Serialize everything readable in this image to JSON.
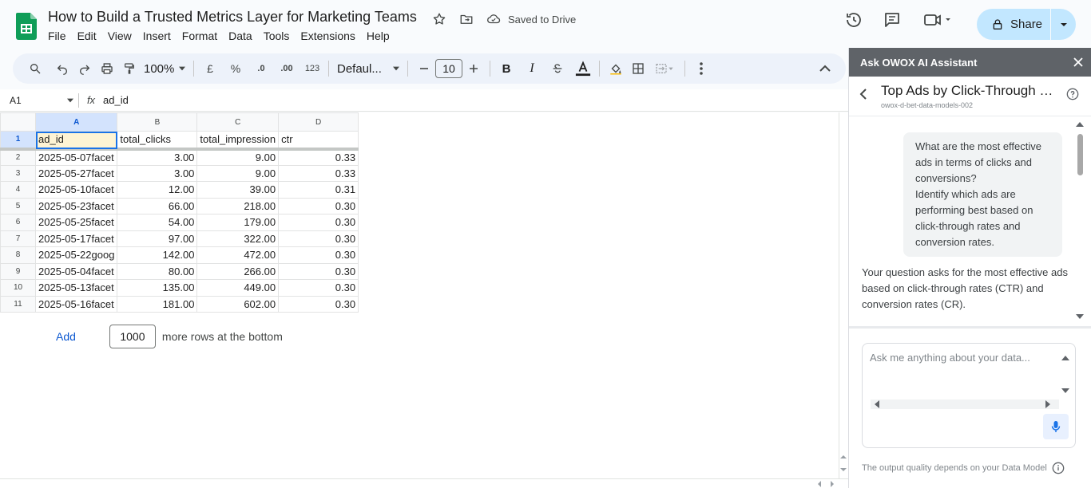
{
  "doc": {
    "title": "How to Build a Trusted Metrics Layer for Marketing Teams",
    "saved_status": "Saved to Drive"
  },
  "menu": [
    "File",
    "Edit",
    "View",
    "Insert",
    "Format",
    "Data",
    "Tools",
    "Extensions",
    "Help"
  ],
  "share": {
    "label": "Share"
  },
  "toolbar": {
    "zoom": "100%",
    "currency": "£",
    "percent": "%",
    "dec_decrease": ".0",
    "dec_increase": ".00",
    "number_format": "123",
    "font": "Defaul...",
    "font_size": "10",
    "bold": "B",
    "italic": "I"
  },
  "formula_bar": {
    "cell_ref": "A1",
    "fx": "fx",
    "value": "ad_id"
  },
  "columns": [
    "A",
    "B",
    "C",
    "D"
  ],
  "rows": [
    {
      "n": "1",
      "cells": [
        "ad_id",
        "total_clicks",
        "total_impression",
        "ctr"
      ]
    },
    {
      "n": "2",
      "cells": [
        "2025-05-07facet",
        "3.00",
        "9.00",
        "0.33"
      ]
    },
    {
      "n": "3",
      "cells": [
        "2025-05-27facet",
        "3.00",
        "9.00",
        "0.33"
      ]
    },
    {
      "n": "4",
      "cells": [
        "2025-05-10facet",
        "12.00",
        "39.00",
        "0.31"
      ]
    },
    {
      "n": "5",
      "cells": [
        "2025-05-23facet",
        "66.00",
        "218.00",
        "0.30"
      ]
    },
    {
      "n": "6",
      "cells": [
        "2025-05-25facet",
        "54.00",
        "179.00",
        "0.30"
      ]
    },
    {
      "n": "7",
      "cells": [
        "2025-05-17facet",
        "97.00",
        "322.00",
        "0.30"
      ]
    },
    {
      "n": "8",
      "cells": [
        "2025-05-22goog",
        "142.00",
        "472.00",
        "0.30"
      ]
    },
    {
      "n": "9",
      "cells": [
        "2025-05-04facet",
        "80.00",
        "266.00",
        "0.30"
      ]
    },
    {
      "n": "10",
      "cells": [
        "2025-05-13facet",
        "135.00",
        "449.00",
        "0.30"
      ]
    },
    {
      "n": "11",
      "cells": [
        "2025-05-16facet",
        "181.00",
        "602.00",
        "0.30"
      ]
    }
  ],
  "add_rows": {
    "button": "Add",
    "count": "1000",
    "suffix": "more rows at the bottom"
  },
  "panel": {
    "header": "Ask OWOX AI Assistant",
    "title": "Top Ads by Click-Through Ra...",
    "subtitle": "owox-d-bet-data-models-002",
    "question": "What are the most effective ads in terms of clicks and conversions?\nIdentify which ads are performing best based on click-through rates and conversion rates.",
    "answer": "Your question asks for the most effective ads based on click-through rates (CTR) and conversion rates (CR).",
    "input_placeholder": "Ask me anything about your data...",
    "footer": "The output quality depends on your Data Model"
  },
  "colors": {
    "accent": "#0b57d0",
    "share_bg": "#c2e7ff",
    "panel_header": "#5f6368",
    "selected_cell_bg": "#fef4d4"
  }
}
